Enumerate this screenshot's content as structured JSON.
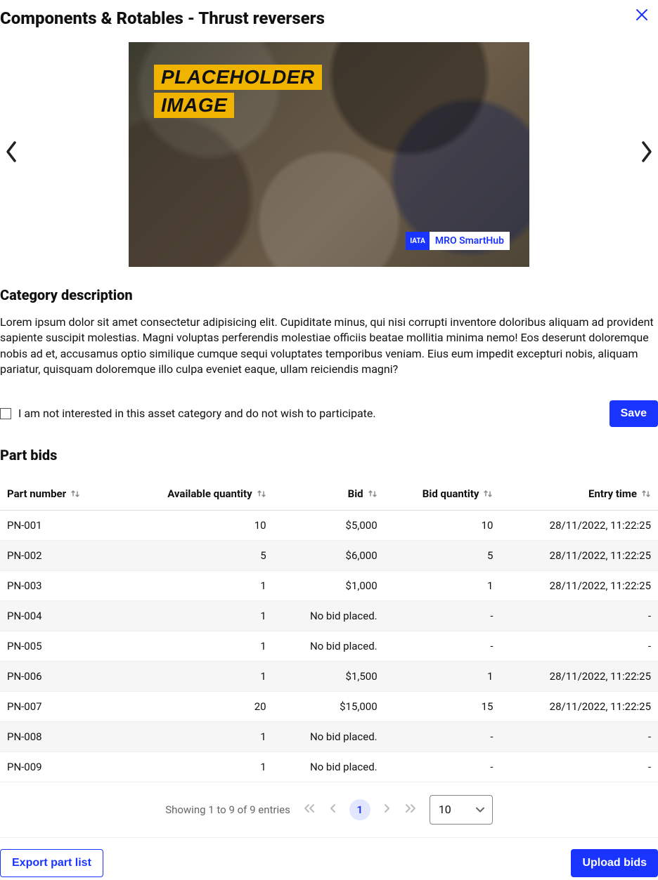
{
  "header": {
    "title": "Components & Rotables - Thrust reversers"
  },
  "carousel": {
    "placeholder_line1": "PLACEHOLDER",
    "placeholder_line2": "IMAGE",
    "watermark_logo": "IATA",
    "watermark_text": "MRO SmartHub"
  },
  "description": {
    "heading": "Category description",
    "body": "Lorem ipsum dolor sit amet consectetur adipisicing elit. Cupiditate minus, qui nisi corrupti inventore doloribus aliquam ad provident sapiente suscipit molestias. Magni voluptas perferendis molestiae officiis beatae mollitia minima nemo! Eos deserunt doloremque nobis ad et, accusamus optio similique cumque sequi voluptates temporibus veniam. Eius eum impedit excepturi nobis, aliquam pariatur, quisquam doloremque illo culpa eveniet eaque, ullam reiciendis magni?"
  },
  "optout": {
    "label": "I am not interested in this asset category and do not wish to participate.",
    "save_label": "Save"
  },
  "table": {
    "heading": "Part bids",
    "columns": {
      "part_number": "Part number",
      "available_quantity": "Available quantity",
      "bid": "Bid",
      "bid_quantity": "Bid quantity",
      "entry_time": "Entry time"
    },
    "rows": [
      {
        "pn": "PN-001",
        "aq": "10",
        "bid": "$5,000",
        "bq": "10",
        "et": "28/11/2022, 11:22:25"
      },
      {
        "pn": "PN-002",
        "aq": "5",
        "bid": "$6,000",
        "bq": "5",
        "et": "28/11/2022, 11:22:25"
      },
      {
        "pn": "PN-003",
        "aq": "1",
        "bid": "$1,000",
        "bq": "1",
        "et": "28/11/2022, 11:22:25"
      },
      {
        "pn": "PN-004",
        "aq": "1",
        "bid": "No bid placed.",
        "bq": "-",
        "et": "-"
      },
      {
        "pn": "PN-005",
        "aq": "1",
        "bid": "No bid placed.",
        "bq": "-",
        "et": "-"
      },
      {
        "pn": "PN-006",
        "aq": "1",
        "bid": "$1,500",
        "bq": "1",
        "et": "28/11/2022, 11:22:25"
      },
      {
        "pn": "PN-007",
        "aq": "20",
        "bid": "$15,000",
        "bq": "15",
        "et": "28/11/2022, 11:22:25"
      },
      {
        "pn": "PN-008",
        "aq": "1",
        "bid": "No bid placed.",
        "bq": "-",
        "et": "-"
      },
      {
        "pn": "PN-009",
        "aq": "1",
        "bid": "No bid placed.",
        "bq": "-",
        "et": "-"
      }
    ]
  },
  "paginator": {
    "status": "Showing 1 to 9 of 9 entries",
    "current_page": "1",
    "page_size": "10"
  },
  "footer": {
    "export_label": "Export part list",
    "upload_label": "Upload bids"
  }
}
